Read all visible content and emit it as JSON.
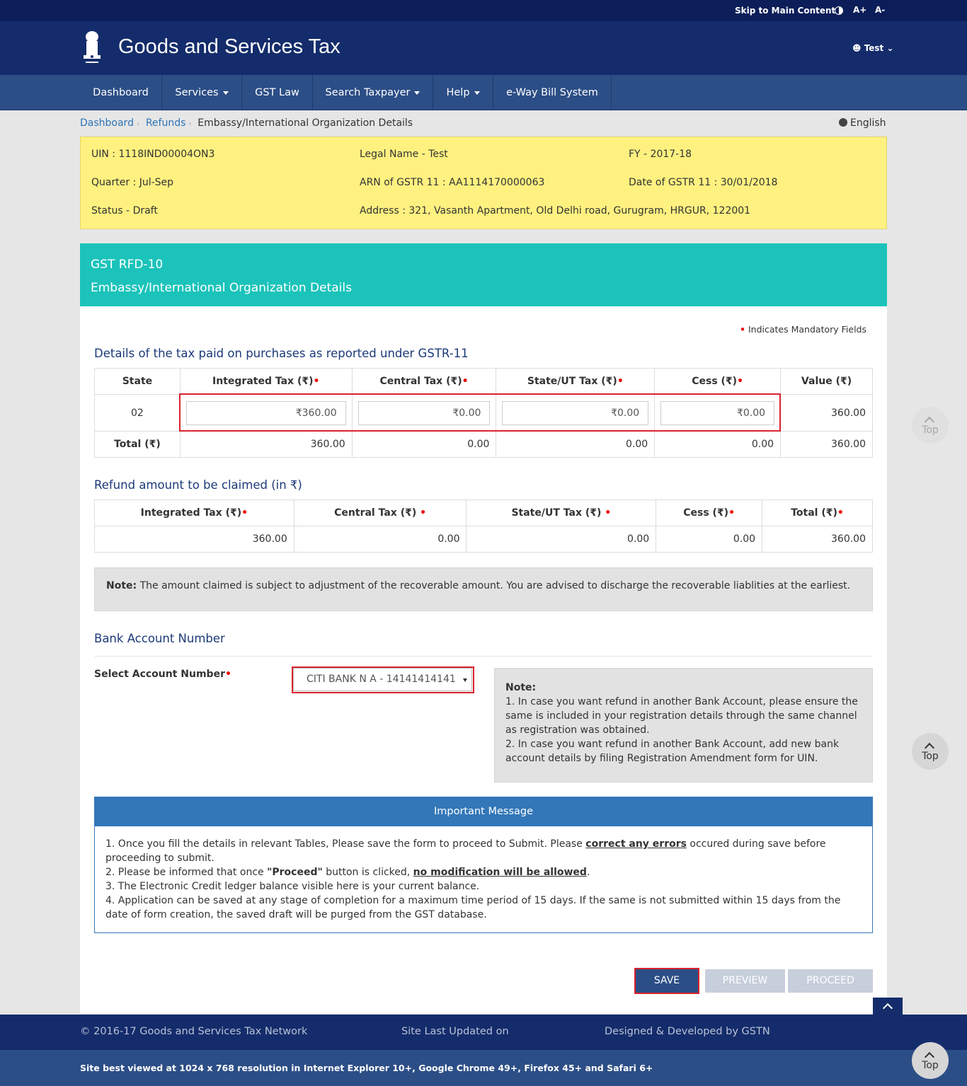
{
  "topbar": {
    "skip": "Skip to Main Content",
    "a_plus": "A+",
    "a_minus": "A-"
  },
  "header": {
    "title": "Goods and Services Tax",
    "user": "Test"
  },
  "nav": {
    "items": [
      "Dashboard",
      "Services",
      "GST Law",
      "Search Taxpayer",
      "Help",
      "e-Way Bill System"
    ]
  },
  "breadcrumb": {
    "items": [
      "Dashboard",
      "Refunds"
    ],
    "current": "Embassy/International Organization Details"
  },
  "language": "English",
  "info": {
    "uin": "UIN : 1118IND00004ON3",
    "legal_name": "Legal Name - Test",
    "fy": "FY - 2017-18",
    "quarter": "Quarter : Jul-Sep",
    "arn": "ARN of GSTR 11 : AA1114170000063",
    "date": "Date of GSTR 11 : 30/01/2018",
    "status": "Status - Draft",
    "address": "Address : 321, Vasanth Apartment, Old Delhi road, Gurugram, HRGUR, 122001"
  },
  "form": {
    "code": "GST RFD-10",
    "title": "Embassy/International Organization Details"
  },
  "mandatory_note": "Indicates Mandatory Fields",
  "tax_table": {
    "title": "Details of the tax paid on purchases as reported under GSTR-11",
    "headers": [
      "State",
      "Integrated Tax (₹)",
      "Central Tax (₹)",
      "State/UT Tax (₹)",
      "Cess (₹)",
      "Value (₹)"
    ],
    "row": {
      "state": "02",
      "igst": "₹360.00",
      "cgst": "₹0.00",
      "sgst": "₹0.00",
      "cess": "₹0.00",
      "value": "360.00"
    },
    "total": {
      "label": "Total (₹)",
      "igst": "360.00",
      "cgst": "0.00",
      "sgst": "0.00",
      "cess": "0.00",
      "value": "360.00"
    }
  },
  "refund_table": {
    "title": "Refund amount to be claimed (in ₹)",
    "headers": [
      "Integrated Tax (₹)",
      "Central Tax (₹)",
      "State/UT Tax (₹)",
      "Cess (₹)",
      "Total (₹)"
    ],
    "values": [
      "360.00",
      "0.00",
      "0.00",
      "0.00",
      "360.00"
    ]
  },
  "note1": {
    "label": "Note:",
    "text": " The amount claimed is subject to adjustment of the recoverable amount. You are advised to discharge the recoverable liablities at the earliest."
  },
  "bank": {
    "title": "Bank Account Number",
    "label": "Select Account Number",
    "selected": "CITI BANK N A - 14141414141"
  },
  "note2": {
    "label": "Note:",
    "line1": "1. In case you want refund in another Bank Account, please ensure the same is included in your registration details through the same channel as registration was obtained.",
    "line2": "2. In case you want refund in another Bank Account, add new bank account details by filing Registration Amendment form for UIN."
  },
  "important": {
    "title": "Important Message",
    "p1a": "1. Once you fill the details in relevant Tables, Please save the form to proceed to Submit. Please ",
    "p1b": "correct any errors",
    "p1c": " occured during save before proceeding to submit.",
    "p2a": "2. Please be informed that once ",
    "p2b": "\"Proceed\"",
    "p2c": " button is clicked, ",
    "p2d": "no modification will be allowed",
    "p2e": ".",
    "p3": "3. The Electronic Credit ledger balance visible here is your current balance.",
    "p4": "4. Application can be saved at any stage of completion for a maximum time period of 15 days. If the same is not submitted within 15 days from the date of form creation, the saved draft will be purged from the GST database."
  },
  "buttons": {
    "save": "SAVE",
    "preview": "PREVIEW",
    "proceed": "PROCEED"
  },
  "footer": {
    "copyright": "© 2016-17 Goods and Services Tax Network",
    "updated": "Site Last Updated on",
    "designed": "Designed & Developed by GSTN",
    "best_viewed": "Site best viewed at 1024 x 768 resolution in Internet Explorer 10+, Google Chrome 49+, Firefox 45+ and Safari 6+"
  },
  "top_label": "Top"
}
